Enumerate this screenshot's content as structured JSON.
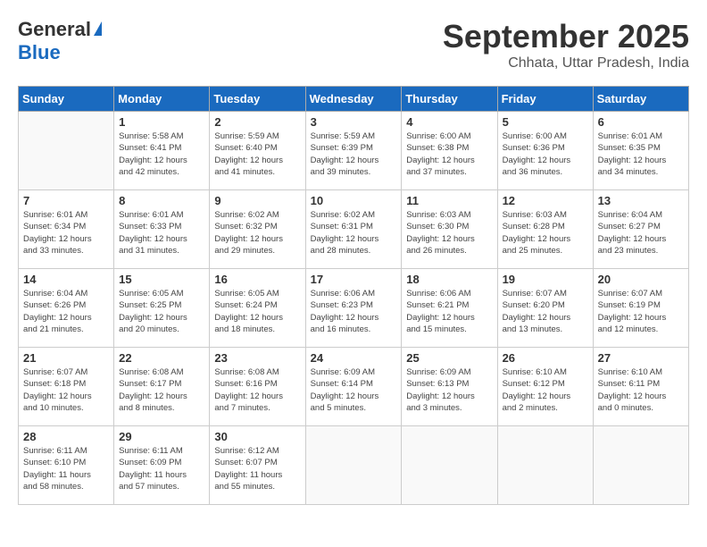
{
  "logo": {
    "line1": "General",
    "line2": "Blue"
  },
  "title": "September 2025",
  "subtitle": "Chhata, Uttar Pradesh, India",
  "days_of_week": [
    "Sunday",
    "Monday",
    "Tuesday",
    "Wednesday",
    "Thursday",
    "Friday",
    "Saturday"
  ],
  "weeks": [
    [
      {
        "day": "",
        "info": ""
      },
      {
        "day": "1",
        "info": "Sunrise: 5:58 AM\nSunset: 6:41 PM\nDaylight: 12 hours\nand 42 minutes."
      },
      {
        "day": "2",
        "info": "Sunrise: 5:59 AM\nSunset: 6:40 PM\nDaylight: 12 hours\nand 41 minutes."
      },
      {
        "day": "3",
        "info": "Sunrise: 5:59 AM\nSunset: 6:39 PM\nDaylight: 12 hours\nand 39 minutes."
      },
      {
        "day": "4",
        "info": "Sunrise: 6:00 AM\nSunset: 6:38 PM\nDaylight: 12 hours\nand 37 minutes."
      },
      {
        "day": "5",
        "info": "Sunrise: 6:00 AM\nSunset: 6:36 PM\nDaylight: 12 hours\nand 36 minutes."
      },
      {
        "day": "6",
        "info": "Sunrise: 6:01 AM\nSunset: 6:35 PM\nDaylight: 12 hours\nand 34 minutes."
      }
    ],
    [
      {
        "day": "7",
        "info": "Sunrise: 6:01 AM\nSunset: 6:34 PM\nDaylight: 12 hours\nand 33 minutes."
      },
      {
        "day": "8",
        "info": "Sunrise: 6:01 AM\nSunset: 6:33 PM\nDaylight: 12 hours\nand 31 minutes."
      },
      {
        "day": "9",
        "info": "Sunrise: 6:02 AM\nSunset: 6:32 PM\nDaylight: 12 hours\nand 29 minutes."
      },
      {
        "day": "10",
        "info": "Sunrise: 6:02 AM\nSunset: 6:31 PM\nDaylight: 12 hours\nand 28 minutes."
      },
      {
        "day": "11",
        "info": "Sunrise: 6:03 AM\nSunset: 6:30 PM\nDaylight: 12 hours\nand 26 minutes."
      },
      {
        "day": "12",
        "info": "Sunrise: 6:03 AM\nSunset: 6:28 PM\nDaylight: 12 hours\nand 25 minutes."
      },
      {
        "day": "13",
        "info": "Sunrise: 6:04 AM\nSunset: 6:27 PM\nDaylight: 12 hours\nand 23 minutes."
      }
    ],
    [
      {
        "day": "14",
        "info": "Sunrise: 6:04 AM\nSunset: 6:26 PM\nDaylight: 12 hours\nand 21 minutes."
      },
      {
        "day": "15",
        "info": "Sunrise: 6:05 AM\nSunset: 6:25 PM\nDaylight: 12 hours\nand 20 minutes."
      },
      {
        "day": "16",
        "info": "Sunrise: 6:05 AM\nSunset: 6:24 PM\nDaylight: 12 hours\nand 18 minutes."
      },
      {
        "day": "17",
        "info": "Sunrise: 6:06 AM\nSunset: 6:23 PM\nDaylight: 12 hours\nand 16 minutes."
      },
      {
        "day": "18",
        "info": "Sunrise: 6:06 AM\nSunset: 6:21 PM\nDaylight: 12 hours\nand 15 minutes."
      },
      {
        "day": "19",
        "info": "Sunrise: 6:07 AM\nSunset: 6:20 PM\nDaylight: 12 hours\nand 13 minutes."
      },
      {
        "day": "20",
        "info": "Sunrise: 6:07 AM\nSunset: 6:19 PM\nDaylight: 12 hours\nand 12 minutes."
      }
    ],
    [
      {
        "day": "21",
        "info": "Sunrise: 6:07 AM\nSunset: 6:18 PM\nDaylight: 12 hours\nand 10 minutes."
      },
      {
        "day": "22",
        "info": "Sunrise: 6:08 AM\nSunset: 6:17 PM\nDaylight: 12 hours\nand 8 minutes."
      },
      {
        "day": "23",
        "info": "Sunrise: 6:08 AM\nSunset: 6:16 PM\nDaylight: 12 hours\nand 7 minutes."
      },
      {
        "day": "24",
        "info": "Sunrise: 6:09 AM\nSunset: 6:14 PM\nDaylight: 12 hours\nand 5 minutes."
      },
      {
        "day": "25",
        "info": "Sunrise: 6:09 AM\nSunset: 6:13 PM\nDaylight: 12 hours\nand 3 minutes."
      },
      {
        "day": "26",
        "info": "Sunrise: 6:10 AM\nSunset: 6:12 PM\nDaylight: 12 hours\nand 2 minutes."
      },
      {
        "day": "27",
        "info": "Sunrise: 6:10 AM\nSunset: 6:11 PM\nDaylight: 12 hours\nand 0 minutes."
      }
    ],
    [
      {
        "day": "28",
        "info": "Sunrise: 6:11 AM\nSunset: 6:10 PM\nDaylight: 11 hours\nand 58 minutes."
      },
      {
        "day": "29",
        "info": "Sunrise: 6:11 AM\nSunset: 6:09 PM\nDaylight: 11 hours\nand 57 minutes."
      },
      {
        "day": "30",
        "info": "Sunrise: 6:12 AM\nSunset: 6:07 PM\nDaylight: 11 hours\nand 55 minutes."
      },
      {
        "day": "",
        "info": ""
      },
      {
        "day": "",
        "info": ""
      },
      {
        "day": "",
        "info": ""
      },
      {
        "day": "",
        "info": ""
      }
    ]
  ]
}
